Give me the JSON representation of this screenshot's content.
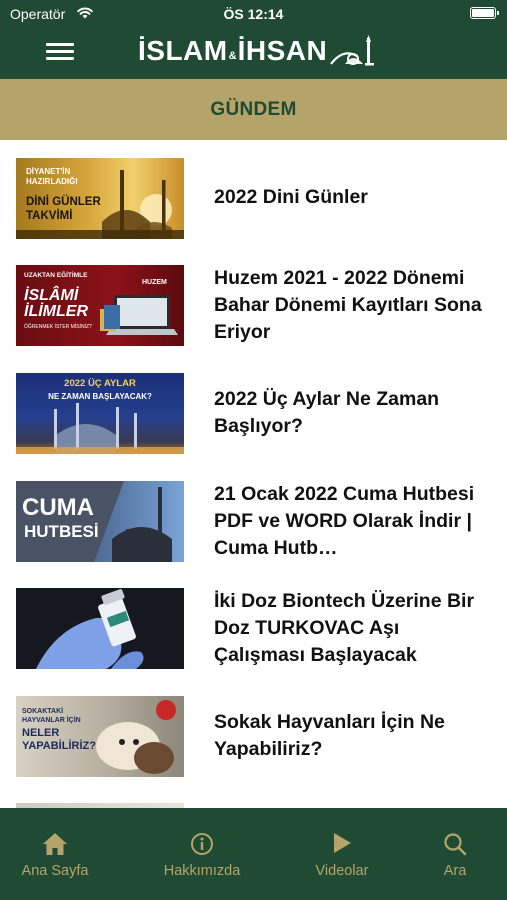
{
  "status_bar": {
    "carrier": "Operatör",
    "time": "ÖS 12:14"
  },
  "header": {
    "logo_part1": "İSLAM",
    "logo_amp": "&",
    "logo_part2": "İHSAN"
  },
  "section": {
    "title": "GÜNDEM"
  },
  "articles": [
    {
      "title": "2022 Dini Günler",
      "thumb_lines": [
        "DİYANET'İN",
        "HAZIRLADIĞI",
        "DİNİ GÜNLER",
        "TAKVİMİ"
      ]
    },
    {
      "title": "Huzem 2021 - 2022 Dönemi Bahar Dönemi Kayıtları Sona Eriyor",
      "thumb_lines": [
        "UZAKTAN EĞİTİMLE",
        "İSLÂMİ",
        "İLİMLER",
        "ÖĞRENMEK İSTER MİSİNİZ?",
        "HUZEM"
      ]
    },
    {
      "title": "2022 Üç Aylar Ne Zaman Başlıyor?",
      "thumb_lines": [
        "2022 ÜÇ AYLAR",
        "NE ZAMAN BAŞLAYACAK?"
      ]
    },
    {
      "title": "21 Ocak 2022 Cuma Hutbesi PDF ve WORD Olarak İndir | Cuma Hutb…",
      "thumb_lines": [
        "CUMA",
        "HUTBESİ"
      ]
    },
    {
      "title": "İki Doz Biontech Üzerine Bir Doz TURKOVAC Aşı Çalışması Başlayacak",
      "thumb_lines": []
    },
    {
      "title": "Sokak Hayvanları İçin Ne Yapabiliriz?",
      "thumb_lines": [
        "SOKAKTAKİ",
        "HAYVANLAR İÇİN",
        "NELER",
        "YAPABİLİRİZ?"
      ]
    }
  ],
  "tabs": [
    {
      "label": "Ana Sayfa",
      "icon": "home-icon",
      "active": true
    },
    {
      "label": "Hakkımızda",
      "icon": "info-icon",
      "active": false
    },
    {
      "label": "Videolar",
      "icon": "play-icon",
      "active": false
    },
    {
      "label": "Ara",
      "icon": "search-icon",
      "active": false
    }
  ],
  "colors": {
    "header_green": "#1f4a33",
    "section_gold": "#b5a46a",
    "tab_label": "#b5a46a",
    "tab_active": "#b5a46a"
  }
}
